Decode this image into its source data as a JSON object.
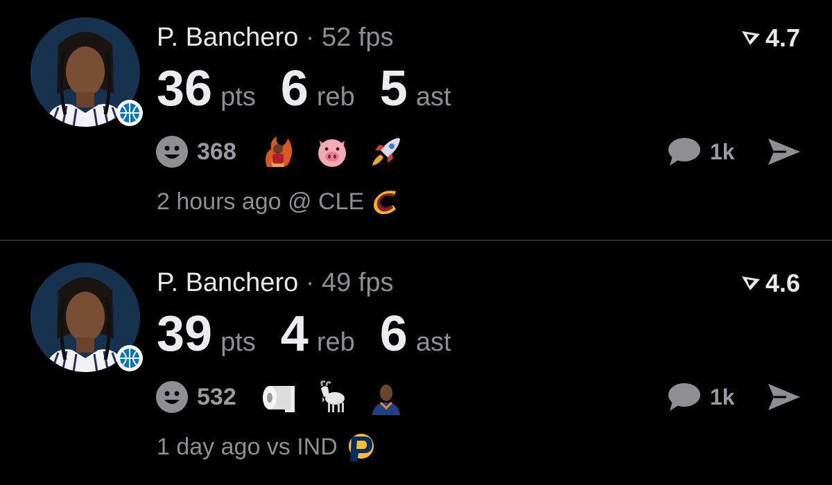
{
  "feed": {
    "cards": [
      {
        "player_name": "P. Banchero",
        "separator": "·",
        "fps": "52 fps",
        "rating": "4.7",
        "stats": [
          {
            "value": "36",
            "unit": "pts"
          },
          {
            "value": "6",
            "unit": "reb"
          },
          {
            "value": "5",
            "unit": "ast"
          }
        ],
        "reaction_count": "368",
        "reaction_emojis": [
          "fire-player-icon",
          "pig-face-icon",
          "rocket-icon"
        ],
        "comment_count": "1k",
        "game_info": "2 hours ago @ CLE",
        "opponent_logo": "cavaliers-logo-icon"
      },
      {
        "player_name": "P. Banchero",
        "separator": "·",
        "fps": "49 fps",
        "rating": "4.6",
        "stats": [
          {
            "value": "39",
            "unit": "pts"
          },
          {
            "value": "4",
            "unit": "reb"
          },
          {
            "value": "6",
            "unit": "ast"
          }
        ],
        "reaction_count": "532",
        "reaction_emojis": [
          "toilet-paper-icon",
          "goat-icon",
          "player-headshot-icon"
        ],
        "comment_count": "1k",
        "game_info": "1 day ago vs IND",
        "opponent_logo": "pacers-logo-icon"
      }
    ]
  },
  "colors": {
    "background": "#000000",
    "primary_text": "#ececee",
    "secondary_text": "#8e8e93",
    "divider": "#2b2b2d",
    "avatar_bg": "#16324f",
    "magic_blue": "#0077c0"
  }
}
